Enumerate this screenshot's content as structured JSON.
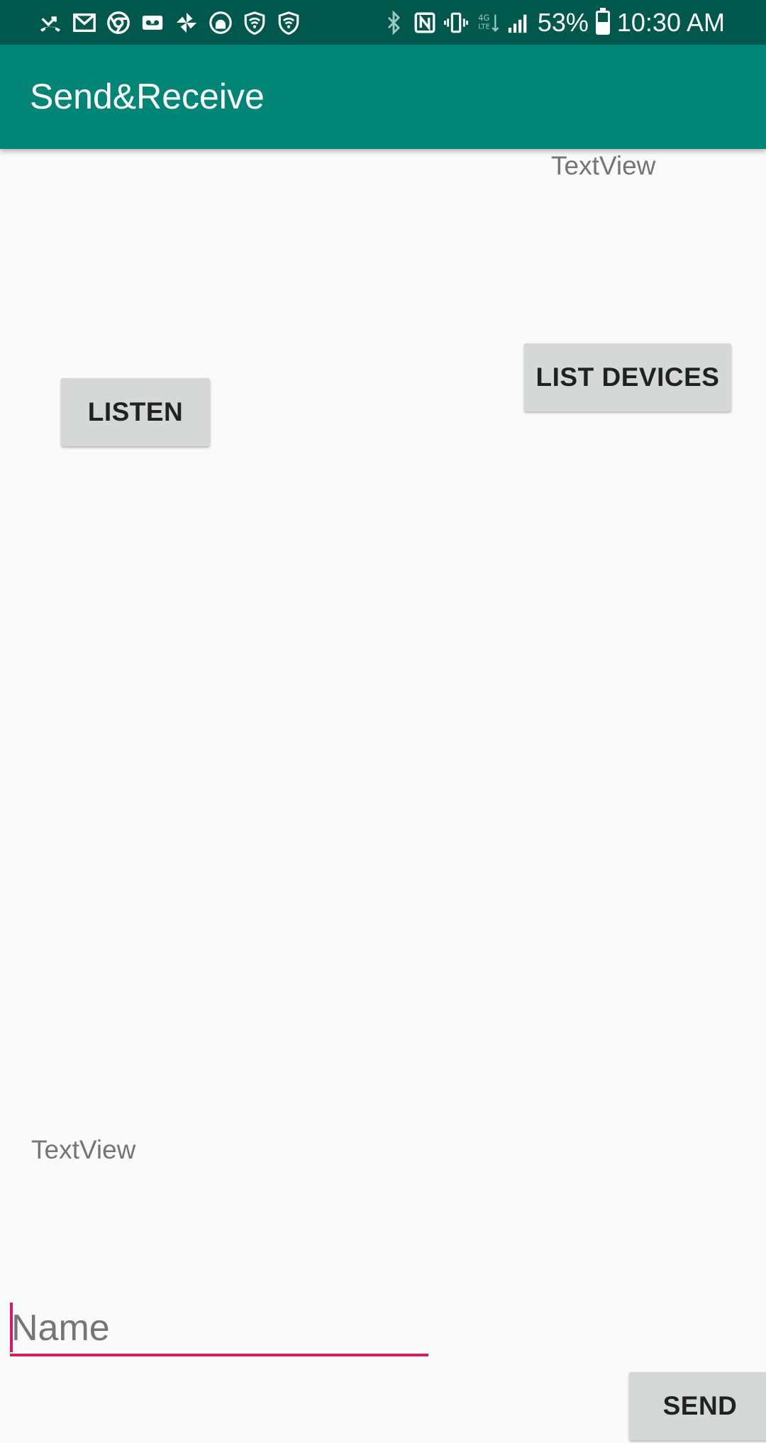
{
  "status_bar": {
    "battery_percent": "53%",
    "time": "10:30 AM",
    "battery_level": 0.53,
    "left_icons": [
      "missed-call-icon",
      "gmail-icon",
      "chrome-icon",
      "voicemail-icon",
      "pinwheel-icon",
      "android-debug-icon",
      "wifi-shield-icon",
      "wifi-shield-icon"
    ],
    "right_icons": [
      "bluetooth-icon",
      "nfc-icon",
      "vibrate-icon",
      "lte-icon",
      "signal-icon",
      "battery-icon"
    ]
  },
  "app_bar": {
    "title": "Send&Receive",
    "color": "#008577",
    "status_color": "#00574b"
  },
  "main": {
    "status_text": "TextView",
    "listen_label": "LISTEN",
    "list_devices_label": "LIST DEVICES",
    "message_text": "TextView",
    "name_input": {
      "value": "",
      "placeholder": "Name",
      "accent_color": "#d81b60"
    },
    "send_label": "SEND"
  }
}
